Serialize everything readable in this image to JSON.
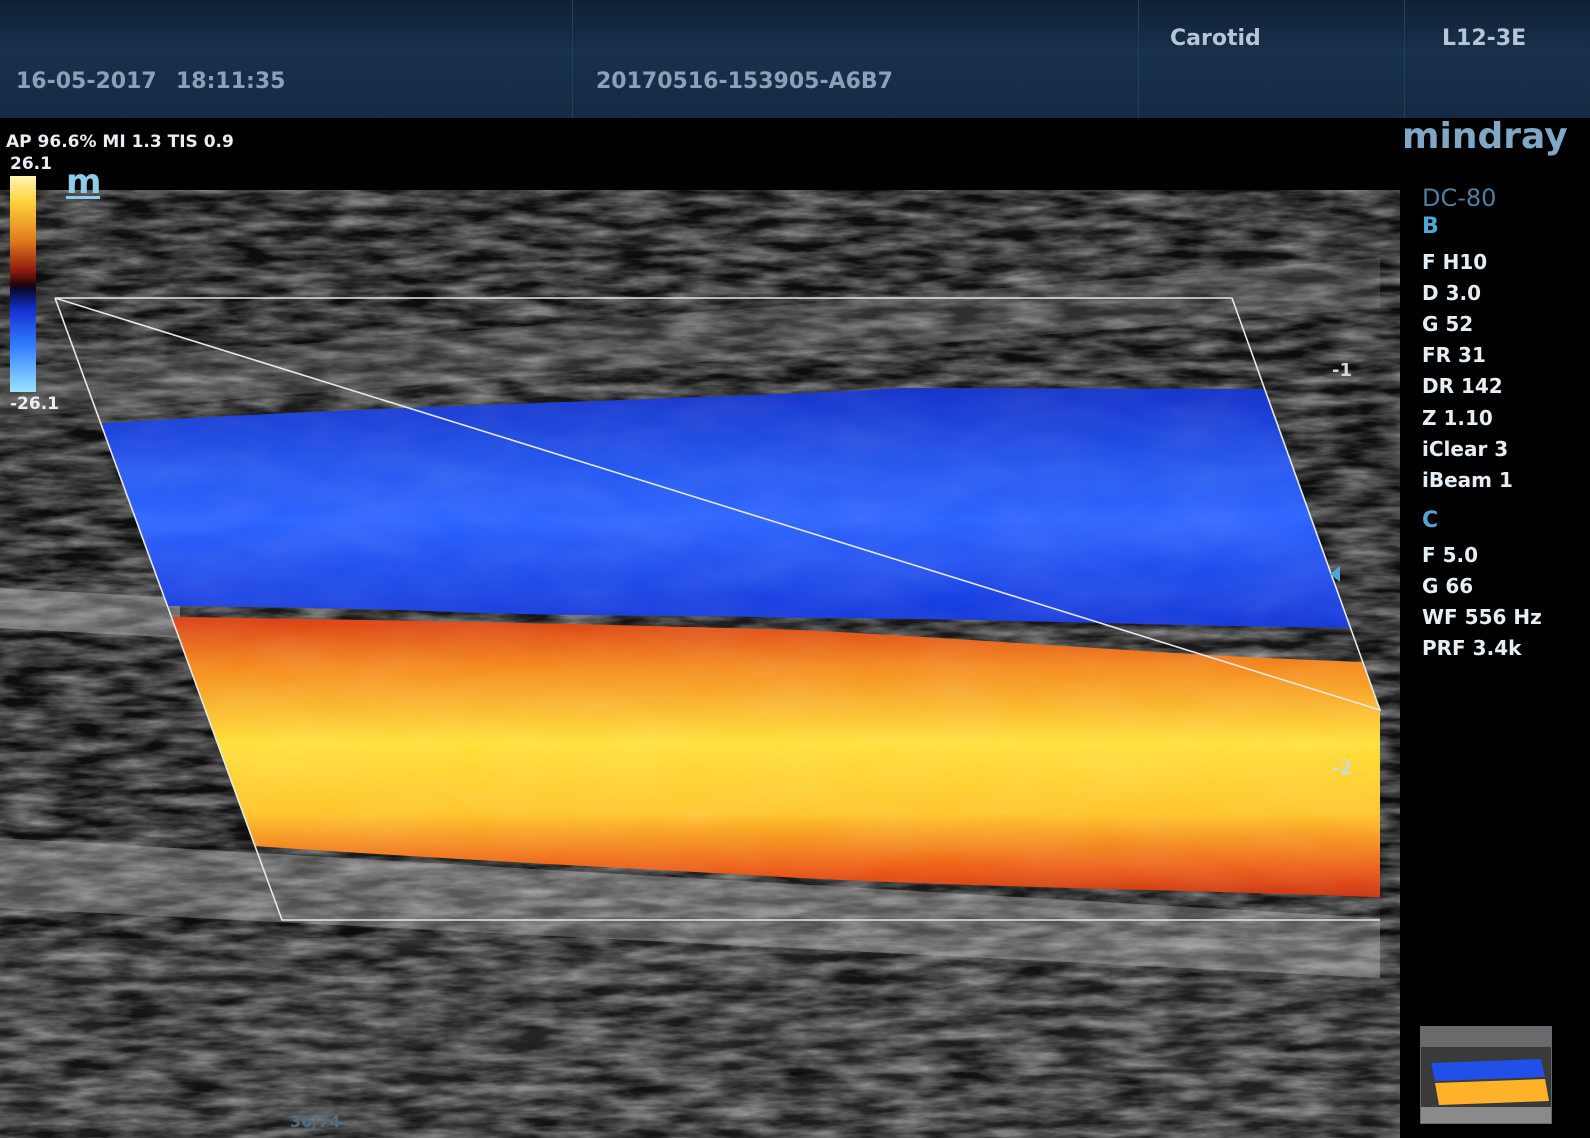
{
  "header": {
    "date": "16-05-2017",
    "time": "18:11:35",
    "exam_id": "20170516-153905-A6B7",
    "preset": "Carotid",
    "probe": "L12-3E"
  },
  "brand": {
    "logo_text": "mindray",
    "model": "DC-80"
  },
  "acoustic": {
    "readout": "AP 96.6%  MI 1.3 TIS 0.9"
  },
  "colorbar": {
    "max": "26.1",
    "min": "-26.1"
  },
  "mode_icon": "m",
  "b_mode": {
    "title": "B",
    "params": [
      "F H10",
      "D 3.0",
      "G 52",
      "FR 31",
      "DR 142",
      "Z 1.10",
      "iClear 3",
      "iBeam 1"
    ]
  },
  "color_mode": {
    "title": "C",
    "params": [
      "F 5.0",
      "G 66",
      "WF 556 Hz",
      "PRF 3.4k"
    ]
  },
  "depth_scale": [
    "1",
    "2"
  ],
  "footer": {
    "frame_counter": "36/74"
  },
  "colors": {
    "venous_flow": "#1f4fe8",
    "arterial_flow": "#ffd23a",
    "accent_label": "#4fa6d6"
  }
}
